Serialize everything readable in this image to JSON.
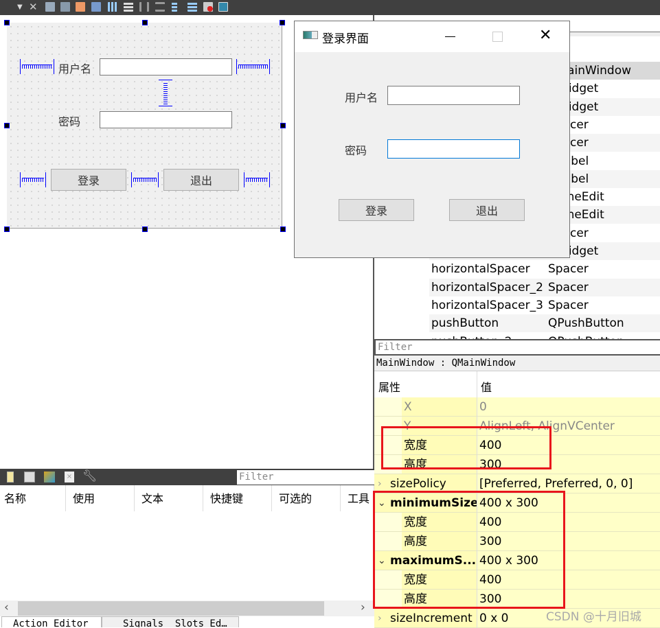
{
  "toolbar": {
    "icons": [
      "dropdown-arrow-icon",
      "close-icon",
      "edit-widgets-icon",
      "edit-signals-slots-icon",
      "edit-buddies-icon",
      "edit-tab-order-icon",
      "layout-horizontal-icon",
      "layout-vertical-icon",
      "layout-h-splitter-icon",
      "layout-v-splitter-icon",
      "layout-form-icon",
      "layout-grid-icon",
      "break-layout-icon",
      "adjust-size-icon"
    ]
  },
  "form": {
    "username_label": "用户名",
    "password_label": "密码",
    "login_button": "登录",
    "exit_button": "退出"
  },
  "dialog": {
    "title": "登录界面",
    "username_label": "用户名",
    "password_label": "密码",
    "username_value": "",
    "password_value": "",
    "login_button": "登录",
    "exit_button": "退出"
  },
  "object_inspector": {
    "rows": [
      {
        "name": "",
        "class": "QMainWindow",
        "selected": true
      },
      {
        "name": "",
        "class": "QWidget"
      },
      {
        "name": "",
        "class": "QWidget"
      },
      {
        "name": "",
        "class": "Spacer"
      },
      {
        "name": "",
        "class": "Spacer"
      },
      {
        "name": "",
        "class": "QLabel"
      },
      {
        "name": "",
        "class": "QLabel"
      },
      {
        "name": "",
        "class": "QLineEdit"
      },
      {
        "name": "",
        "class": "QLineEdit"
      },
      {
        "name": "",
        "class": "Spacer"
      },
      {
        "name": "",
        "class": "QWidget"
      },
      {
        "name": "horizontalSpacer",
        "class": "Spacer"
      },
      {
        "name": "horizontalSpacer_2",
        "class": "Spacer"
      },
      {
        "name": "horizontalSpacer_3",
        "class": "Spacer"
      },
      {
        "name": "pushButton",
        "class": "QPushButton"
      },
      {
        "name": "pushButton_2",
        "class": "QPushButton"
      }
    ]
  },
  "property_editor": {
    "filter_placeholder": "Filter",
    "object_label": "MainWindow : QMainWindow",
    "header_property": "属性",
    "header_value": "值",
    "rows": [
      {
        "name": "X",
        "value": "0",
        "indent": true,
        "dim": true
      },
      {
        "name": "Y",
        "value": "AlignLeft, AlignVCenter",
        "indent": true,
        "dim": true
      },
      {
        "name": "宽度",
        "value": "400",
        "indent": true
      },
      {
        "name": "高度",
        "value": "300",
        "indent": true
      },
      {
        "name": "sizePolicy",
        "value": "[Preferred, Preferred, 0, 0]",
        "expander": "collapsed"
      },
      {
        "name": "minimumSize",
        "value": "400 x 300",
        "expander": "expanded",
        "bold": true
      },
      {
        "name": "宽度",
        "value": "400",
        "indent": true
      },
      {
        "name": "高度",
        "value": "300",
        "indent": true
      },
      {
        "name": "maximumS...",
        "value": "400 x 300",
        "expander": "expanded",
        "bold": true
      },
      {
        "name": "宽度",
        "value": "400",
        "indent": true
      },
      {
        "name": "高度",
        "value": "300",
        "indent": true
      },
      {
        "name": "sizeIncrement",
        "value": "0 x 0",
        "expander": "collapsed"
      }
    ]
  },
  "action_editor": {
    "filter_placeholder": "Filter",
    "columns": [
      "名称",
      "使用",
      "文本",
      "快捷键",
      "可选的",
      "工具"
    ],
    "tabs": [
      "Action Editor",
      "Signals _Slots Ed…"
    ]
  },
  "watermark": "CSDN @十月旧城",
  "colors": {
    "highlight_box": "#e8151b",
    "property_bg": "#ffffc8",
    "spacer": "#0000ff",
    "focus_border": "#0078d7"
  }
}
